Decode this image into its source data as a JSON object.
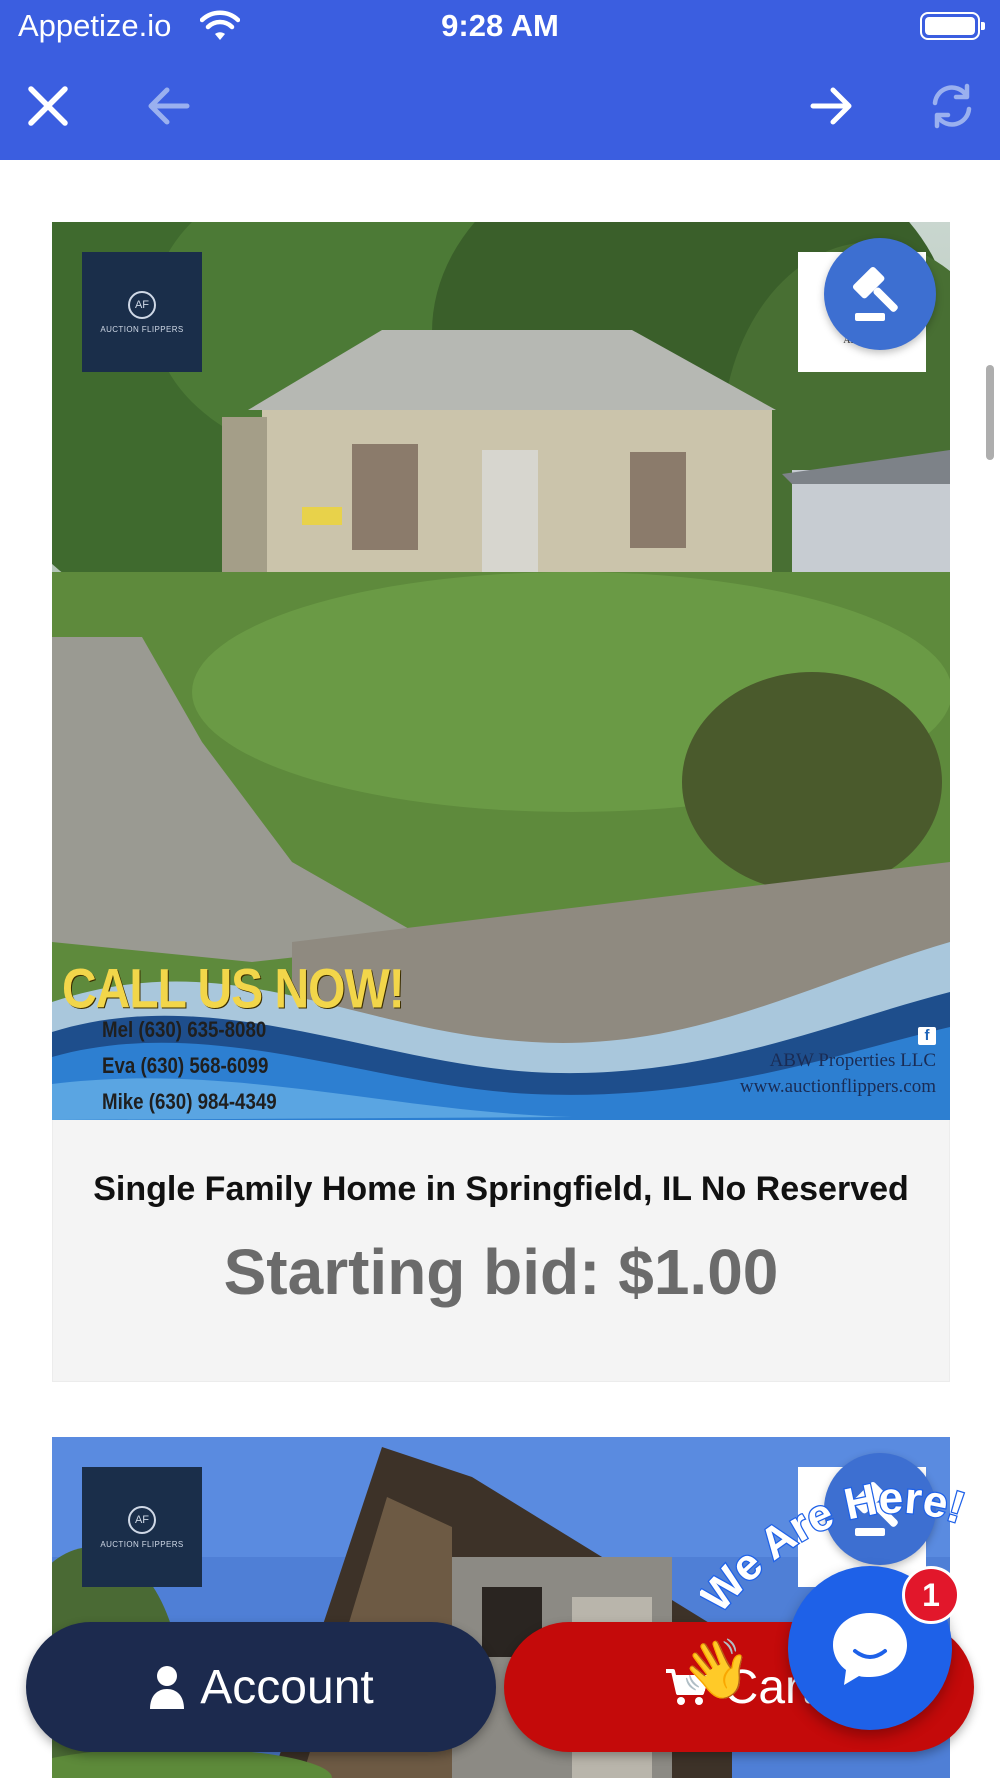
{
  "status_bar": {
    "carrier": "Appetize.io",
    "time": "9:28 AM"
  },
  "toolbar": {
    "close_icon": "close-icon",
    "back_icon": "arrow-left-icon",
    "forward_icon": "arrow-right-icon",
    "reload_icon": "refresh-icon"
  },
  "listings": [
    {
      "title": "Single Family Home in Springfield, IL No Reserved",
      "starting_bid": "Starting bid: $1.00",
      "image": {
        "banner_headline": "CALL US NOW!",
        "phones": [
          "Mel (630) 635-8080",
          "Eva (630) 568-6099",
          "Mike (630) 984-4349"
        ],
        "company": "ABW Properties LLC",
        "website": "www.auctionflippers.com",
        "logo_text": "AUCTION FLIPPERS"
      }
    },
    {
      "image": {
        "logo_text": "AUCTION FLIPPERS"
      }
    }
  ],
  "bottom_bar": {
    "account_label": "Account",
    "cart_label": "Cart"
  },
  "chat": {
    "greeting": "We Are Here!",
    "badge_count": "1"
  },
  "colors": {
    "toolbar_blue": "#3b5ee0",
    "account_navy": "#1c2a4e",
    "cart_red": "#c40a0a",
    "chat_blue": "#1e61e8",
    "badge_red": "#e2172b",
    "bid_gray": "#6b6b6b"
  }
}
